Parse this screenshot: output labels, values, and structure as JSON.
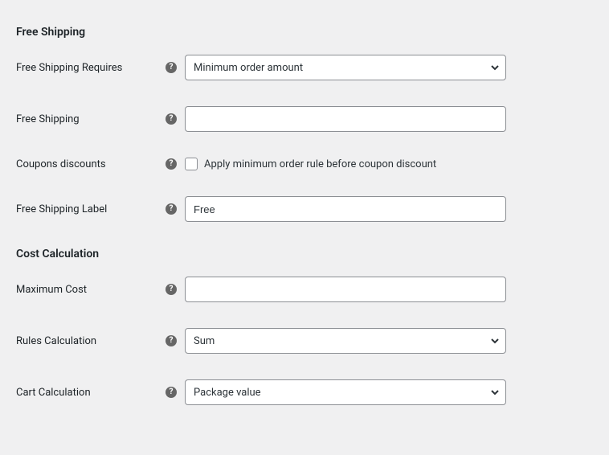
{
  "sections": {
    "free_shipping": {
      "heading": "Free Shipping",
      "requires": {
        "label": "Free Shipping Requires",
        "value": "Minimum order amount"
      },
      "free_shipping_field": {
        "label": "Free Shipping",
        "value": ""
      },
      "coupons": {
        "label": "Coupons discounts",
        "checkbox_label": "Apply minimum order rule before coupon discount",
        "checked": false
      },
      "shipping_label_field": {
        "label": "Free Shipping Label",
        "value": "Free"
      }
    },
    "cost_calculation": {
      "heading": "Cost Calculation",
      "max_cost": {
        "label": "Maximum Cost",
        "value": ""
      },
      "rules": {
        "label": "Rules Calculation",
        "value": "Sum"
      },
      "cart": {
        "label": "Cart Calculation",
        "value": "Package value"
      }
    }
  },
  "help_tooltip_char": "?"
}
